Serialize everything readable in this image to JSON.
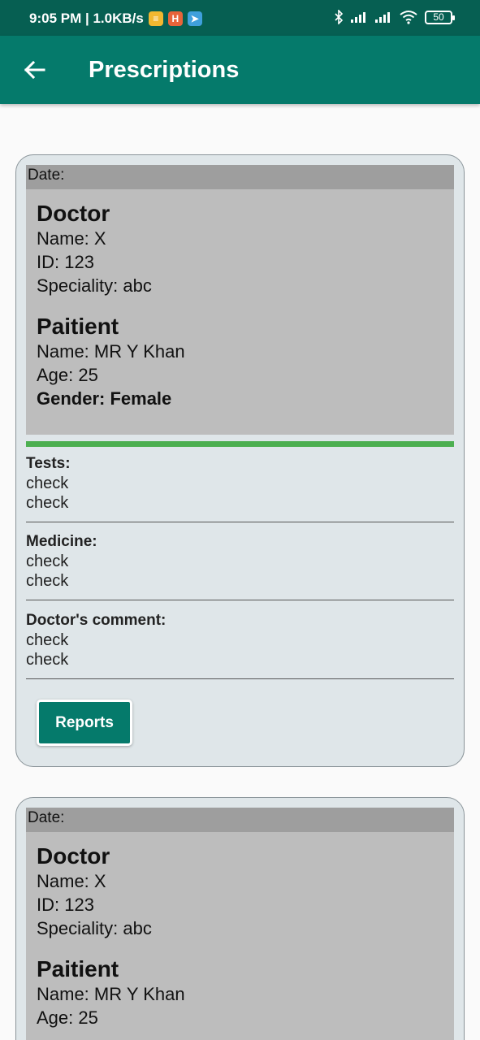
{
  "status": {
    "time_speed": "9:05 PM | 1.0KB/s",
    "battery": "50"
  },
  "appbar": {
    "title": "Prescriptions"
  },
  "cards": [
    {
      "date_label": "Date:",
      "doctor_heading": "Doctor",
      "doctor_name": "Name: X",
      "doctor_id": "ID:  123",
      "doctor_speciality": "Speciality:  abc",
      "patient_heading": "Paitient",
      "patient_name": "Name: MR Y Khan",
      "patient_age": "Age: 25",
      "patient_gender": "Gender:  Female",
      "tests_title": "Tests:",
      "tests": [
        "check",
        "check"
      ],
      "medicine_title": "Medicine:",
      "medicine": [
        "check",
        "check"
      ],
      "comment_title": "Doctor's comment:",
      "comment": [
        "check",
        "check"
      ],
      "reports_label": "Reports"
    },
    {
      "date_label": "Date:",
      "doctor_heading": "Doctor",
      "doctor_name": "Name: X",
      "doctor_id": "ID:  123",
      "doctor_speciality": "Speciality:  abc",
      "patient_heading": "Paitient",
      "patient_name": "Name: MR Y Khan",
      "patient_age": "Age: 25"
    }
  ]
}
